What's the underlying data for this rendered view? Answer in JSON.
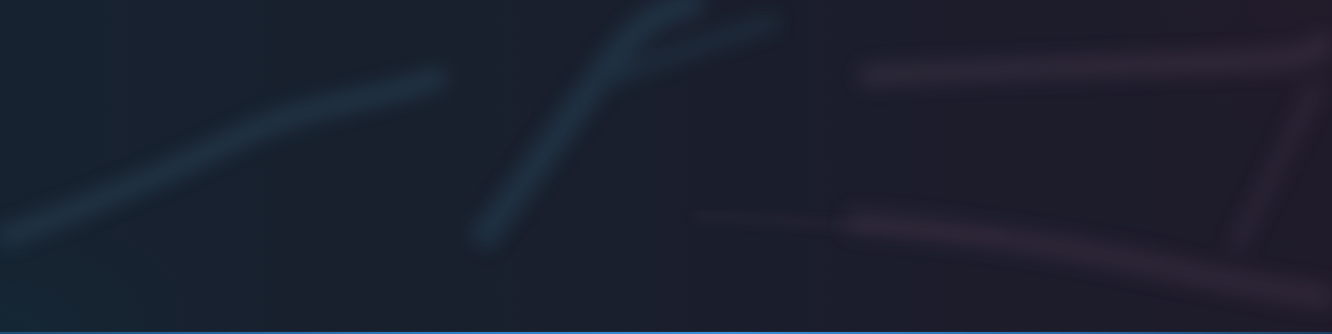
{
  "hero": {
    "accent_color": "#2f7fc4",
    "background_color": "#1a1f2c",
    "streak_colors": {
      "teal": "#2a4a5c",
      "violet": "#4a3a4e"
    }
  }
}
